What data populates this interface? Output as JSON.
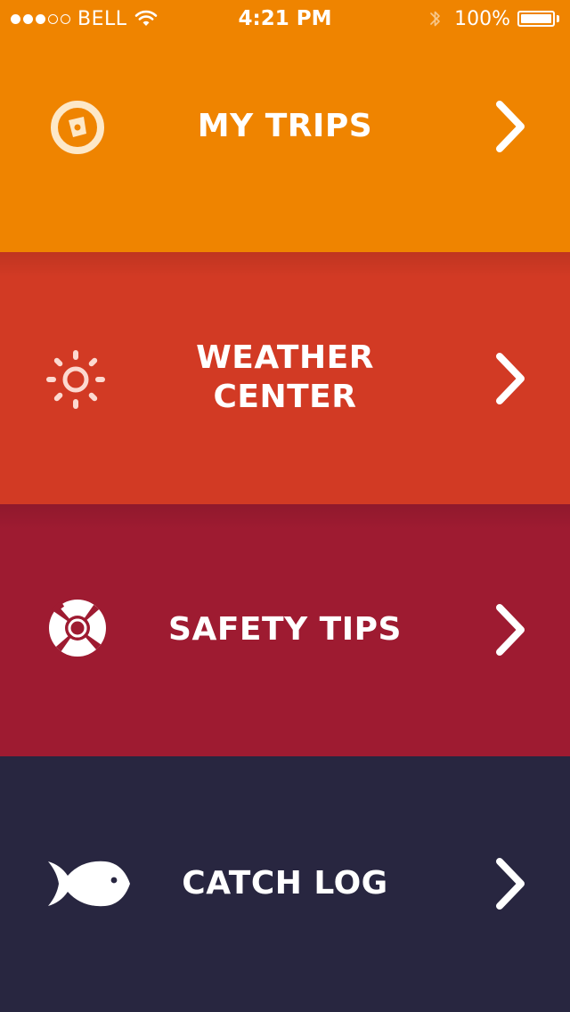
{
  "status_bar": {
    "carrier": "BELL",
    "time": "4:21 PM",
    "battery_percent": "100%",
    "signal_strength_bars_filled": 3,
    "signal_strength_bars_total": 5
  },
  "menu": {
    "items": [
      {
        "label": "MY TRIPS",
        "icon": "compass-icon",
        "color": "#EF8400"
      },
      {
        "label": "WEATHER\nCENTER",
        "icon": "sun-icon",
        "color": "#D23A24"
      },
      {
        "label": "SAFETY TIPS",
        "icon": "lifebuoy-icon",
        "color": "#9E1B31"
      },
      {
        "label": "CATCH LOG",
        "icon": "fish-icon",
        "color": "#282640"
      }
    ]
  }
}
